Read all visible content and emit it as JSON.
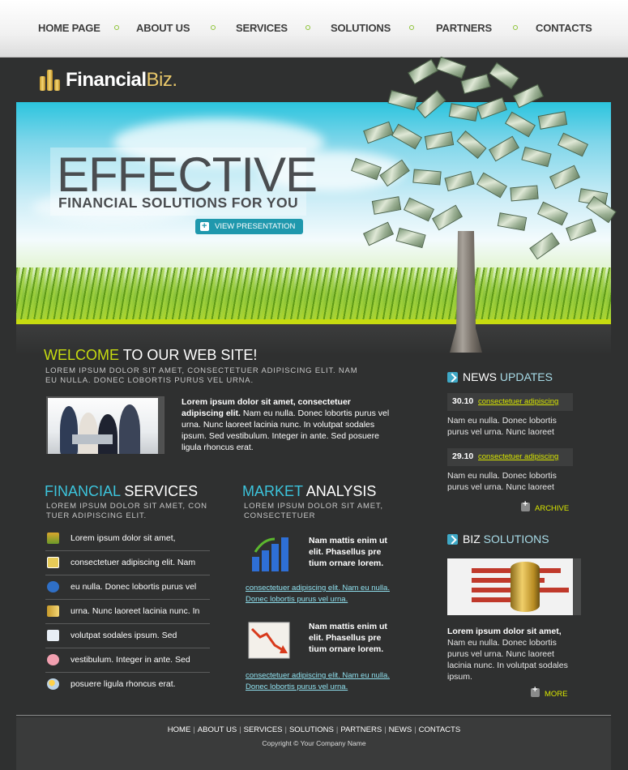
{
  "nav": {
    "items": [
      "HOME PAGE",
      "ABOUT US",
      "SERVICES",
      "SOLUTIONS",
      "PARTNERS",
      "CONTACTS"
    ]
  },
  "logo": {
    "part1": "Financial",
    "part2": "Biz."
  },
  "hero": {
    "title": "EFFECTIVE",
    "subtitle": "FINANCIAL SOLUTIONS FOR YOU",
    "button": "VIEW PRESENTATION"
  },
  "welcome": {
    "heading_accent": "WELCOME",
    "heading_rest": "TO OUR WEB SITE!",
    "sub": "LOREM IPSUM DOLOR SIT AMET, CONSECTETUER ADIPISCING ELIT. NAM EU NULLA. DONEC LOBORTIS PURUS VEL URNA.",
    "bold": "Lorem ipsum dolor sit amet, consectetuer adipiscing elit.",
    "text": " Nam eu nulla. Donec lobortis purus vel urna. Nunc laoreet lacinia nunc. In volutpat sodales ipsum. Sed vestibulum. Integer in ante. Sed posuere ligula rhoncus erat."
  },
  "services": {
    "heading_accent": "FINANCIAL",
    "heading_rest": "SERVICES",
    "sub": "LOREM IPSUM DOLOR SIT AMET, CON TUER ADIPISCING ELIT.",
    "items": [
      {
        "text": "Lorem ipsum dolor sit amet,",
        "icon": "chart-icon"
      },
      {
        "text": "consectetuer adipiscing elit. Nam",
        "icon": "card-icon"
      },
      {
        "text": "eu nulla. Donec lobortis purus vel",
        "icon": "euro-icon"
      },
      {
        "text": "urna. Nunc laoreet lacinia nunc. In",
        "icon": "coins-icon"
      },
      {
        "text": "volutpat sodales ipsum. Sed",
        "icon": "document-icon"
      },
      {
        "text": "vestibulum. Integer in ante. Sed",
        "icon": "piggy-bank-icon"
      },
      {
        "text": "posuere ligula rhoncus erat.",
        "icon": "weather-icon"
      }
    ]
  },
  "market": {
    "heading_accent": "MARKET",
    "heading_rest": "ANALYSIS",
    "sub": "LOREM IPSUM DOLOR SIT AMET, CONSECTETUER",
    "blocks": [
      {
        "bold": "Nam mattis enim ut elit. Phasellus pre tium ornare lorem.",
        "link": "consectetuer adipiscing elit. Nam eu nulla. Donec lobortis purus vel urna."
      },
      {
        "bold": "Nam mattis enim ut elit. Phasellus pre tium ornare lorem.",
        "link": "consectetuer adipiscing elit. Nam eu nulla. Donec lobortis purus vel urna."
      }
    ]
  },
  "news": {
    "heading_a": "NEWS",
    "heading_b": "UPDATES",
    "items": [
      {
        "date": "30.10",
        "link": "consectetuer adipiscing",
        "text": "Nam eu nulla. Donec lobortis purus vel urna. Nunc laoreet"
      },
      {
        "date": "29.10",
        "link": "consectetuer adipiscing",
        "text": "Nam eu nulla. Donec lobortis purus vel urna. Nunc laoreet"
      }
    ],
    "archive": "ARCHIVE"
  },
  "biz": {
    "heading_a": "BIZ",
    "heading_b": "SOLUTIONS",
    "bold": "Lorem ipsum dolor sit amet,",
    "text": "Nam eu nulla. Donec lobortis purus vel urna. Nunc laoreet lacinia nunc. In volutpat sodales ipsum.",
    "more": "MORE"
  },
  "footer": {
    "links": [
      "HOME",
      "ABOUT US",
      "SERVICES",
      "SOLUTIONS",
      "PARTNERS",
      "NEWS",
      "CONTACTS"
    ],
    "copyright": "Copyright © Your Company Name"
  },
  "colors": {
    "accent_green": "#c7dc10",
    "accent_blue": "#3cc4dc",
    "background": "#2f3030"
  }
}
